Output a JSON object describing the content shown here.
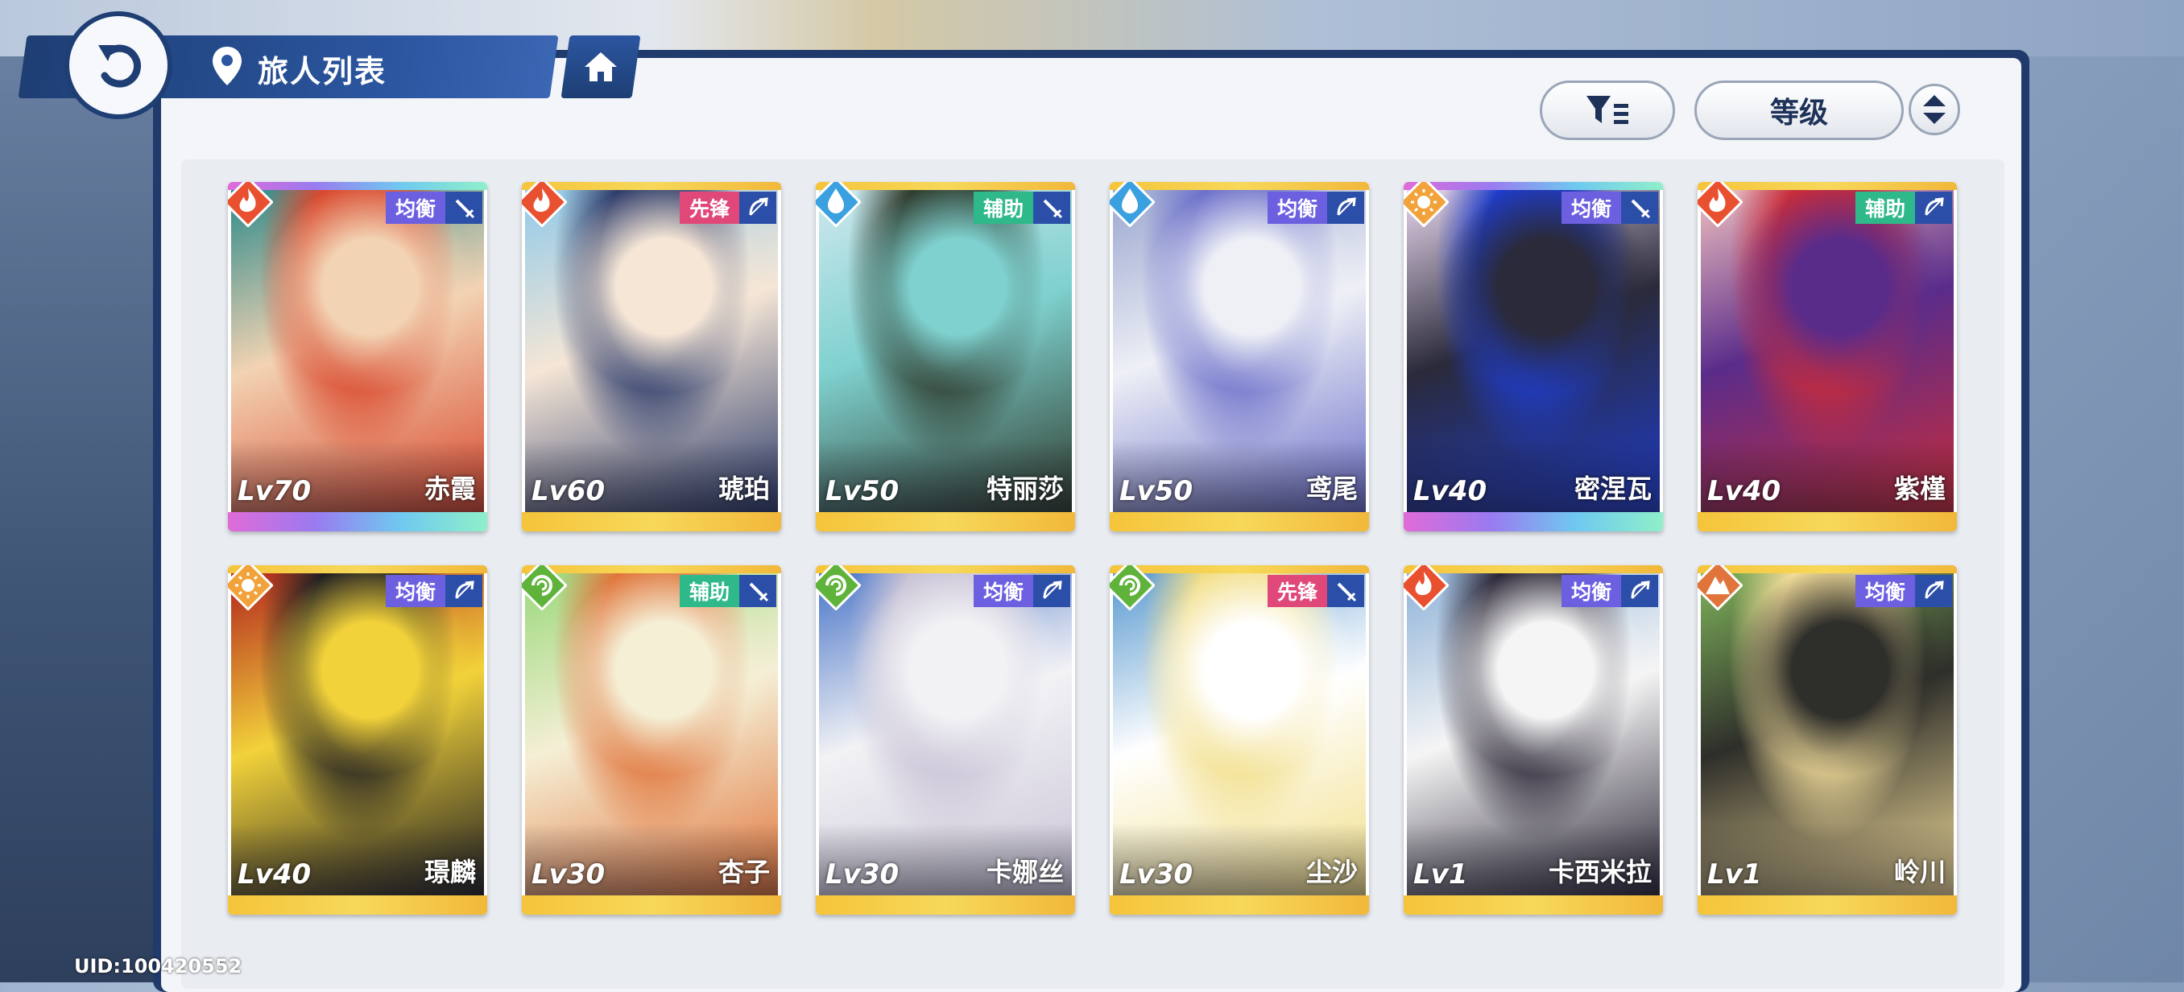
{
  "header": {
    "title": "旅人列表"
  },
  "toolbar": {
    "sort_label": "等级"
  },
  "footer": {
    "uid": "UID:100420552"
  },
  "colors": {
    "fire": "#e8502f",
    "water": "#3aa0e0",
    "light": "#f2a23a",
    "wind": "#5fb33a",
    "earth": "#e0743a",
    "balance": "#6c5fe0",
    "vanguard": "#e0487a",
    "support": "#2fb98a"
  },
  "characters": [
    {
      "name": "赤霞",
      "level": "Lv70",
      "role": "均衡",
      "element": "fire",
      "weapon": "sword",
      "frame": "rainbow",
      "art": [
        "#d9472c",
        "#f2d3b3",
        "#2e8a8a"
      ]
    },
    {
      "name": "琥珀",
      "level": "Lv60",
      "role": "先锋",
      "element": "fire",
      "weapon": "bow",
      "frame": "gold",
      "art": [
        "#2c3b6a",
        "#f5e6d6",
        "#8fc9e8"
      ]
    },
    {
      "name": "特丽莎",
      "level": "Lv50",
      "role": "辅助",
      "element": "water",
      "weapon": "sword",
      "frame": "gold",
      "art": [
        "#2e3a2c",
        "#7fd1cf",
        "#cfe8ee"
      ]
    },
    {
      "name": "鸢尾",
      "level": "Lv50",
      "role": "均衡",
      "element": "water",
      "weapon": "bow",
      "frame": "gold",
      "art": [
        "#6b6fc9",
        "#eef0f6",
        "#9aa6cf"
      ]
    },
    {
      "name": "密涅瓦",
      "level": "Lv40",
      "role": "均衡",
      "element": "light",
      "weapon": "sword",
      "frame": "rainbow",
      "art": [
        "#1f3cc9",
        "#2a2a3a",
        "#e8d7ee"
      ]
    },
    {
      "name": "紫槿",
      "level": "Lv40",
      "role": "辅助",
      "element": "fire",
      "weapon": "bow",
      "frame": "gold",
      "art": [
        "#c92c3a",
        "#5a2c8a",
        "#f0c0c0"
      ]
    },
    {
      "name": "璟麟",
      "level": "Lv40",
      "role": "均衡",
      "element": "light",
      "weapon": "bow",
      "frame": "gold",
      "art": [
        "#1e1e22",
        "#f2d23a",
        "#b3261e"
      ]
    },
    {
      "name": "杏子",
      "level": "Lv30",
      "role": "辅助",
      "element": "wind",
      "weapon": "sword",
      "frame": "gold",
      "art": [
        "#e0743a",
        "#f5efd6",
        "#9ad87a"
      ]
    },
    {
      "name": "卡娜丝",
      "level": "Lv30",
      "role": "均衡",
      "element": "wind",
      "weapon": "bow",
      "frame": "gold",
      "art": [
        "#c9c3d6",
        "#f2f2f5",
        "#4a76c9"
      ]
    },
    {
      "name": "尘沙",
      "level": "Lv30",
      "role": "先锋",
      "element": "wind",
      "weapon": "sword",
      "frame": "gold",
      "art": [
        "#f2df8a",
        "#ffffff",
        "#5a9ad0"
      ]
    },
    {
      "name": "卡西米拉",
      "level": "Lv1",
      "role": "均衡",
      "element": "fire",
      "weapon": "bow",
      "frame": "gold",
      "art": [
        "#2a2535",
        "#f5f5f5",
        "#8fb3d9"
      ]
    },
    {
      "name": "岭川",
      "level": "Lv1",
      "role": "均衡",
      "element": "earth",
      "weapon": "bow",
      "frame": "gold",
      "art": [
        "#f2dc9a",
        "#2e2e2a",
        "#7fb35a"
      ]
    }
  ]
}
